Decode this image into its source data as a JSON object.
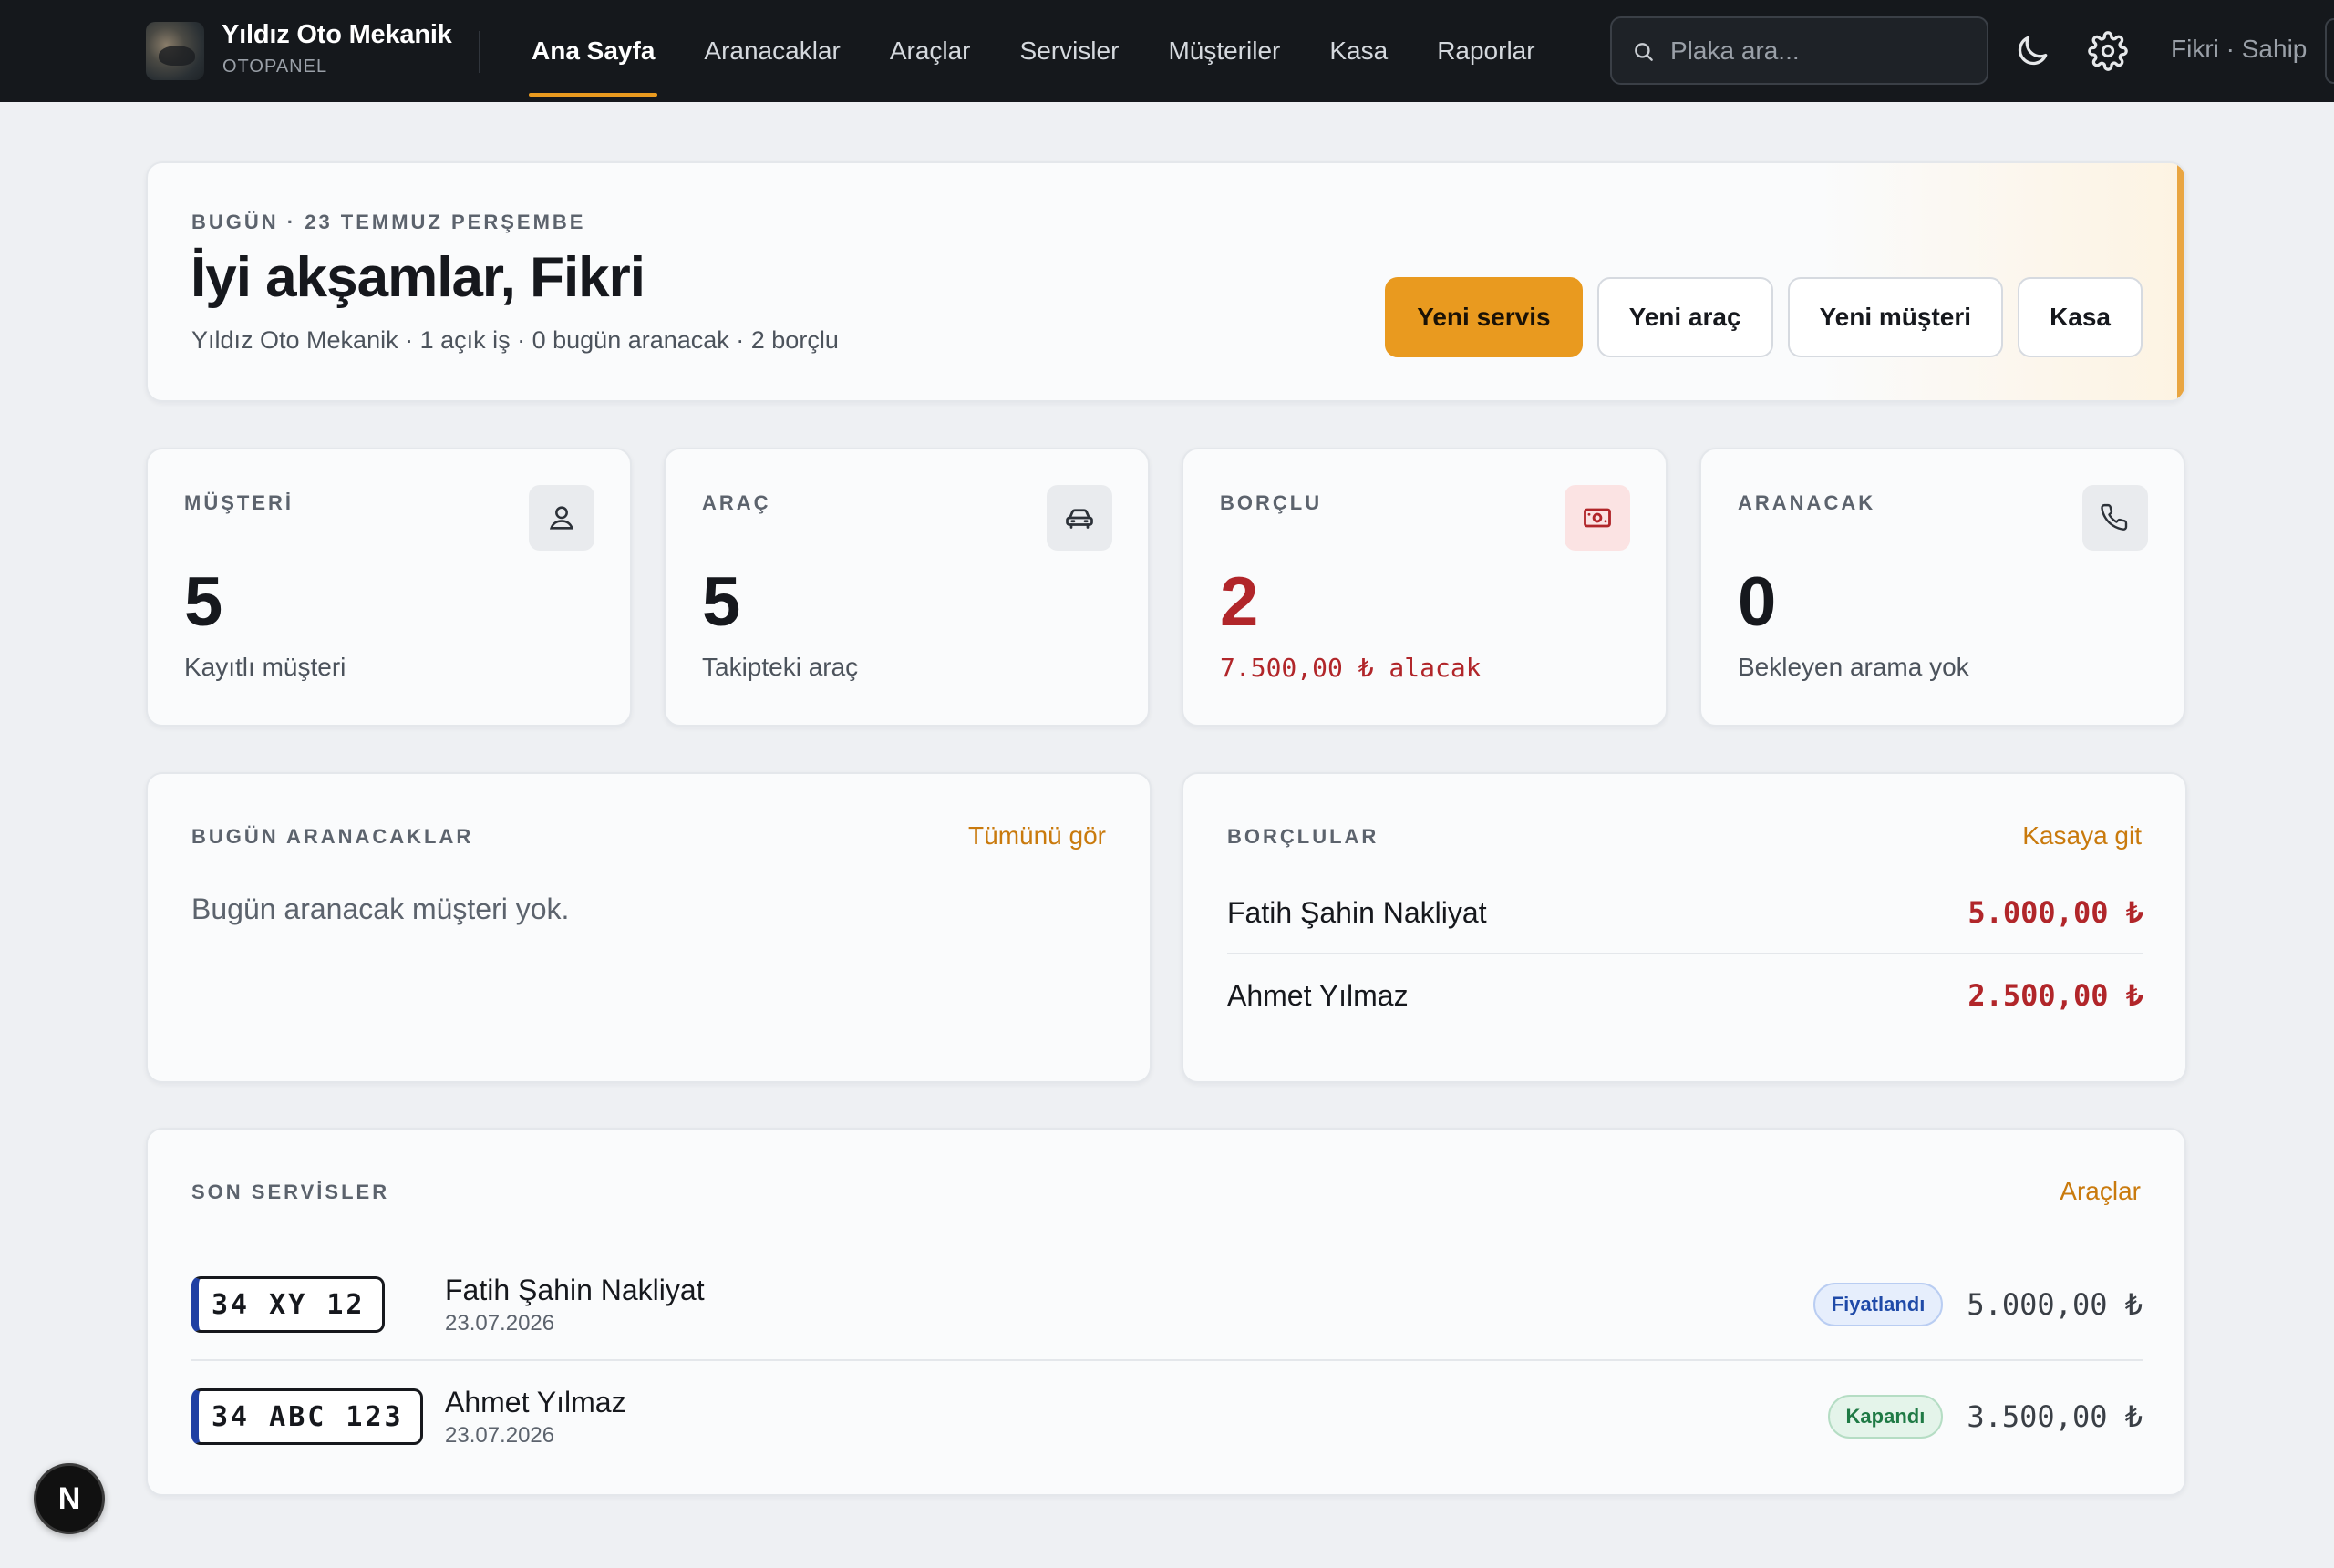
{
  "header": {
    "brand_name": "Yıldız Oto Mekanik",
    "brand_sub": "OTOPANEL",
    "nav": [
      {
        "label": "Ana Sayfa",
        "active": true
      },
      {
        "label": "Aranacaklar"
      },
      {
        "label": "Araçlar"
      },
      {
        "label": "Servisler"
      },
      {
        "label": "Müşteriler"
      },
      {
        "label": "Kasa"
      },
      {
        "label": "Raporlar"
      }
    ],
    "search_placeholder": "Plaka ara...",
    "user": "Fikri · Sahip"
  },
  "hero": {
    "date": "BUGÜN · 23 TEMMUZ PERŞEMBE",
    "greeting": "İyi akşamlar, Fikri",
    "summary": "Yıldız Oto Mekanik · 1 açık iş · 0 bugün aranacak · 2 borçlu",
    "actions": {
      "new_service": "Yeni servis",
      "new_vehicle": "Yeni araç",
      "new_customer": "Yeni müşteri",
      "cash": "Kasa"
    }
  },
  "stats": {
    "customers": {
      "label": "MÜŞTERİ",
      "value": "5",
      "caption": "Kayıtlı müşteri",
      "icon": "user-icon"
    },
    "vehicles": {
      "label": "ARAÇ",
      "value": "5",
      "caption": "Takipteki araç",
      "icon": "car-icon"
    },
    "debtors": {
      "label": "BORÇLU",
      "value": "2",
      "caption": "7.500,00 ₺ alacak",
      "icon": "banknote-icon"
    },
    "calls": {
      "label": "ARANACAK",
      "value": "0",
      "caption": "Bekleyen arama yok",
      "icon": "phone-icon"
    }
  },
  "calls_today": {
    "title": "BUGÜN ARANACAKLAR",
    "link": "Tümünü gör",
    "empty": "Bugün aranacak müşteri yok."
  },
  "debtors": {
    "title": "BORÇLULAR",
    "link": "Kasaya git",
    "items": [
      {
        "name": "Fatih Şahin Nakliyat",
        "amount": "5.000,00 ₺"
      },
      {
        "name": "Ahmet Yılmaz",
        "amount": "2.500,00 ₺"
      }
    ]
  },
  "recent_services": {
    "title": "SON SERVİSLER",
    "link": "Araçlar",
    "items": [
      {
        "plate": "34 XY 12",
        "customer": "Fatih Şahin Nakliyat",
        "date": "23.07.2026",
        "status": "Fiyatlandı",
        "amount": "5.000,00 ₺"
      },
      {
        "plate": "34 ABC 123",
        "customer": "Ahmet Yılmaz",
        "date": "23.07.2026",
        "status": "Kapandı",
        "amount": "3.500,00 ₺"
      }
    ]
  },
  "fab_label": "N",
  "colors": {
    "accent": "#e99a1f",
    "topbar": "#15181c",
    "danger": "#b1262a",
    "link": "#c97a0d",
    "plate_band": "#1f3fa3"
  }
}
